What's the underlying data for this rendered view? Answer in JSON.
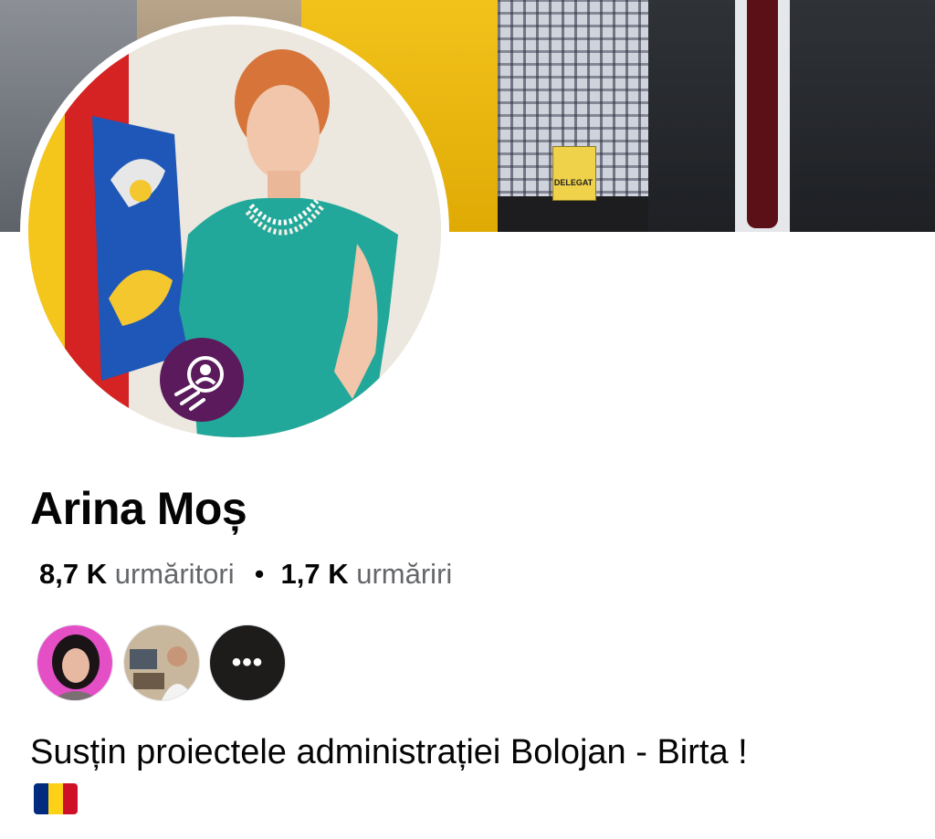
{
  "cover": {
    "badge_text": "DELEGAT"
  },
  "profile": {
    "name": "Arina Moș",
    "followers_count": "8,7 K",
    "followers_label": "urmăritori",
    "separator": "•",
    "following_count": "1,7 K",
    "following_label": "urmăriri",
    "mutual_more_label": "•••",
    "bio": "Susțin proiectele administrației Bolojan - Birta !",
    "bio_flag": "romania-flag-icon"
  },
  "colors": {
    "primary_text": "#050505",
    "secondary_text": "#65676b",
    "flag": [
      "#002b7f",
      "#fcd116",
      "#ce1126"
    ],
    "frame_badge": "#5b1a5c"
  }
}
